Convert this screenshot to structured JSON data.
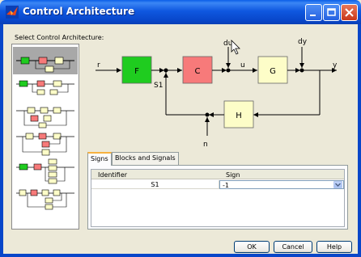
{
  "window": {
    "title": "Control Architecture"
  },
  "select_label": "Select Control Architecture:",
  "diagram": {
    "blocks": [
      "F",
      "C",
      "G",
      "H"
    ],
    "signals": [
      "r",
      "du",
      "u",
      "dy",
      "y",
      "S1",
      "n"
    ],
    "colors": {
      "F": "#1fcc1f",
      "C": "#f77a7a",
      "G": "#fdfdc8",
      "H": "#fdfdc8"
    }
  },
  "tabs": [
    {
      "label": "Signs",
      "active": true
    },
    {
      "label": "Blocks and Signals",
      "active": false
    }
  ],
  "table": {
    "columns": [
      "Identifier",
      "Sign"
    ],
    "rows": [
      {
        "identifier": "S1",
        "sign": "-1"
      }
    ]
  },
  "buttons": {
    "ok": "OK",
    "cancel": "Cancel",
    "help": "Help"
  }
}
